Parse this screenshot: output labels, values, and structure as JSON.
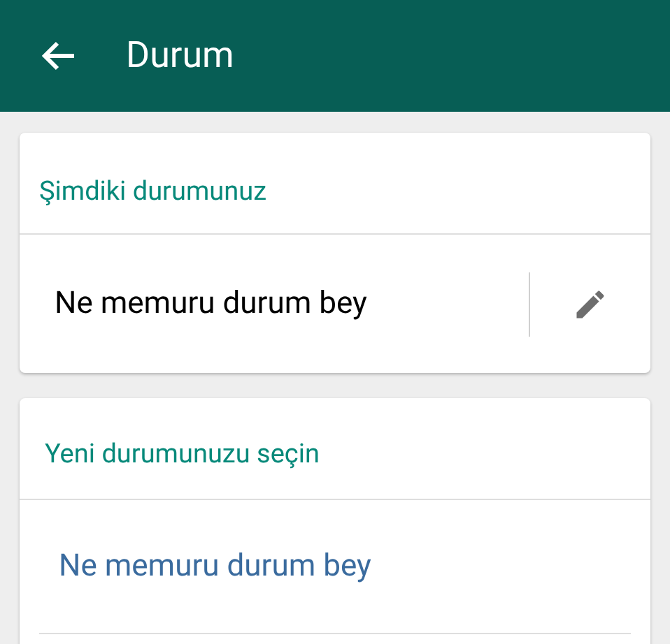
{
  "app_bar": {
    "title": "Durum"
  },
  "current_status": {
    "heading": "Şimdiki durumunuz",
    "text": "Ne memuru durum bey"
  },
  "new_status": {
    "heading": "Yeni durumunuzu seçin",
    "items": [
      {
        "label": "Ne memuru durum bey",
        "selected": true
      }
    ]
  }
}
